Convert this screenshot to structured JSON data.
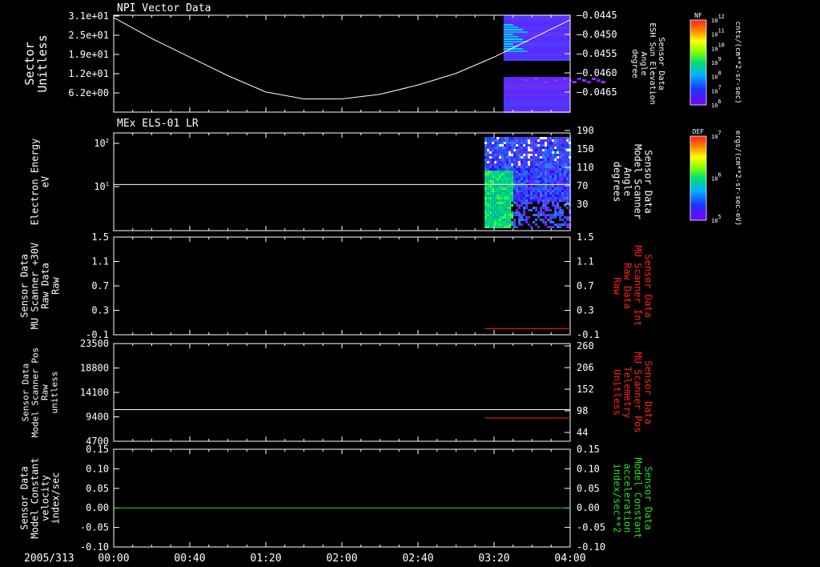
{
  "date_label": "2005/313",
  "x_ticks": [
    "00:00",
    "00:40",
    "01:20",
    "02:00",
    "02:40",
    "03:20",
    "04:00"
  ],
  "colors": {
    "axis": "#ffffff",
    "red": "#ff2020",
    "green": "#22dd22",
    "bg": "#000000"
  },
  "chart_data": [
    {
      "type": "heatmap",
      "title": "NPI Vector Data",
      "ylabel": "Sector\nUnitless",
      "y_ticks": [
        "3.1e+01",
        "2.5e+01",
        "1.9e+01",
        "1.2e+01",
        "6.2e+00"
      ],
      "y_right_label": "Sensor Data\nESH Sun Elevation\nAngle\ndegree",
      "y_right_ticks": [
        "-0.0445",
        "-0.0450",
        "-0.0455",
        "-0.0460",
        "-0.0465"
      ],
      "y_right_color": "#ffffff",
      "colorbar": {
        "title": "NF",
        "units": "cnts/(cm**2-sr-sec)",
        "ticks": [
          "10^12",
          "10^11",
          "10^10",
          "10^9",
          "10^8",
          "10^7",
          "10^6"
        ]
      },
      "data_start": "03:25",
      "line": {
        "x": [
          "00:00",
          "00:20",
          "00:40",
          "01:00",
          "01:20",
          "01:40",
          "02:00",
          "02:20",
          "02:40",
          "03:00",
          "03:20",
          "03:40",
          "04:00"
        ],
        "y": [
          -0.04455,
          -0.045,
          -0.0454,
          -0.0458,
          -0.04615,
          -0.0463,
          -0.0463,
          -0.0462,
          -0.046,
          -0.04575,
          -0.0454,
          -0.045,
          -0.0446
        ]
      }
    },
    {
      "type": "heatmap",
      "title": "MEx ELS-01 LR",
      "ylabel": "Electron Energy\neV",
      "y_ticks": [
        "10^2",
        "10^1"
      ],
      "y_right_label": "Sensor Data\nModel Scanner\nAngle\ndegrees",
      "y_right_ticks": [
        "190",
        "150",
        "110",
        "70",
        "30"
      ],
      "y_right_color": "#ffffff",
      "colorbar": {
        "title": "DEF",
        "units": "ergs/(cm**2-sr-sec-eV)",
        "ticks": [
          "10^7",
          "10^6",
          "10^5"
        ]
      },
      "data_start": "03:15",
      "line": {
        "value": 95
      }
    },
    {
      "type": "line",
      "ylabel": "Sensor Data\nMU Scanner +30V\nRaw Data\nRaw",
      "y_ticks": [
        "1.5",
        "1.1",
        "0.7",
        "0.3",
        "-0.1"
      ],
      "y_right_label": "Sensor Data\nMU Scanner Int\nRaw Data\nRaw",
      "y_right_ticks": [
        "1.5",
        "1.1",
        "0.7",
        "0.3",
        "-0.1"
      ],
      "y_right_color": "#ff2020",
      "series": [
        {
          "color": "#ff2020",
          "x": [
            "03:15",
            "04:00"
          ],
          "value": 0.0
        }
      ]
    },
    {
      "type": "line",
      "ylabel": "Sensor Data\nModel Scanner Pos\nRaw\nunitless",
      "y_ticks": [
        "23500",
        "18800",
        "14100",
        "9400",
        "4700"
      ],
      "y_right_label": "Sensor Data\nMU Scanner Pos\nTelemetry\nUnitless",
      "y_right_ticks": [
        "260",
        "206",
        "152",
        "98",
        "44"
      ],
      "y_right_color": "#ff2020",
      "series": [
        {
          "color": "#ffffff",
          "x": [
            "00:00",
            "04:00"
          ],
          "value": 11750
        },
        {
          "color": "#ff2020",
          "x": [
            "03:15",
            "04:00"
          ],
          "value": 80
        }
      ]
    },
    {
      "type": "line",
      "ylabel": "Sensor Data\nModel Constant\nvelocity\nindex/sec",
      "y_ticks": [
        "0.15",
        "0.10",
        "0.05",
        "0.00",
        "-0.05",
        "-0.10"
      ],
      "y_right_label": "Sensor Data\nModel Constant\nacceleration\nindex/sec**2",
      "y_right_ticks": [
        "0.15",
        "0.10",
        "0.05",
        "0.00",
        "-0.05",
        "-0.10"
      ],
      "y_right_color": "#22dd22",
      "series": [
        {
          "color": "#22dd22",
          "x": [
            "00:00",
            "04:00"
          ],
          "value": 0.0
        }
      ]
    }
  ]
}
